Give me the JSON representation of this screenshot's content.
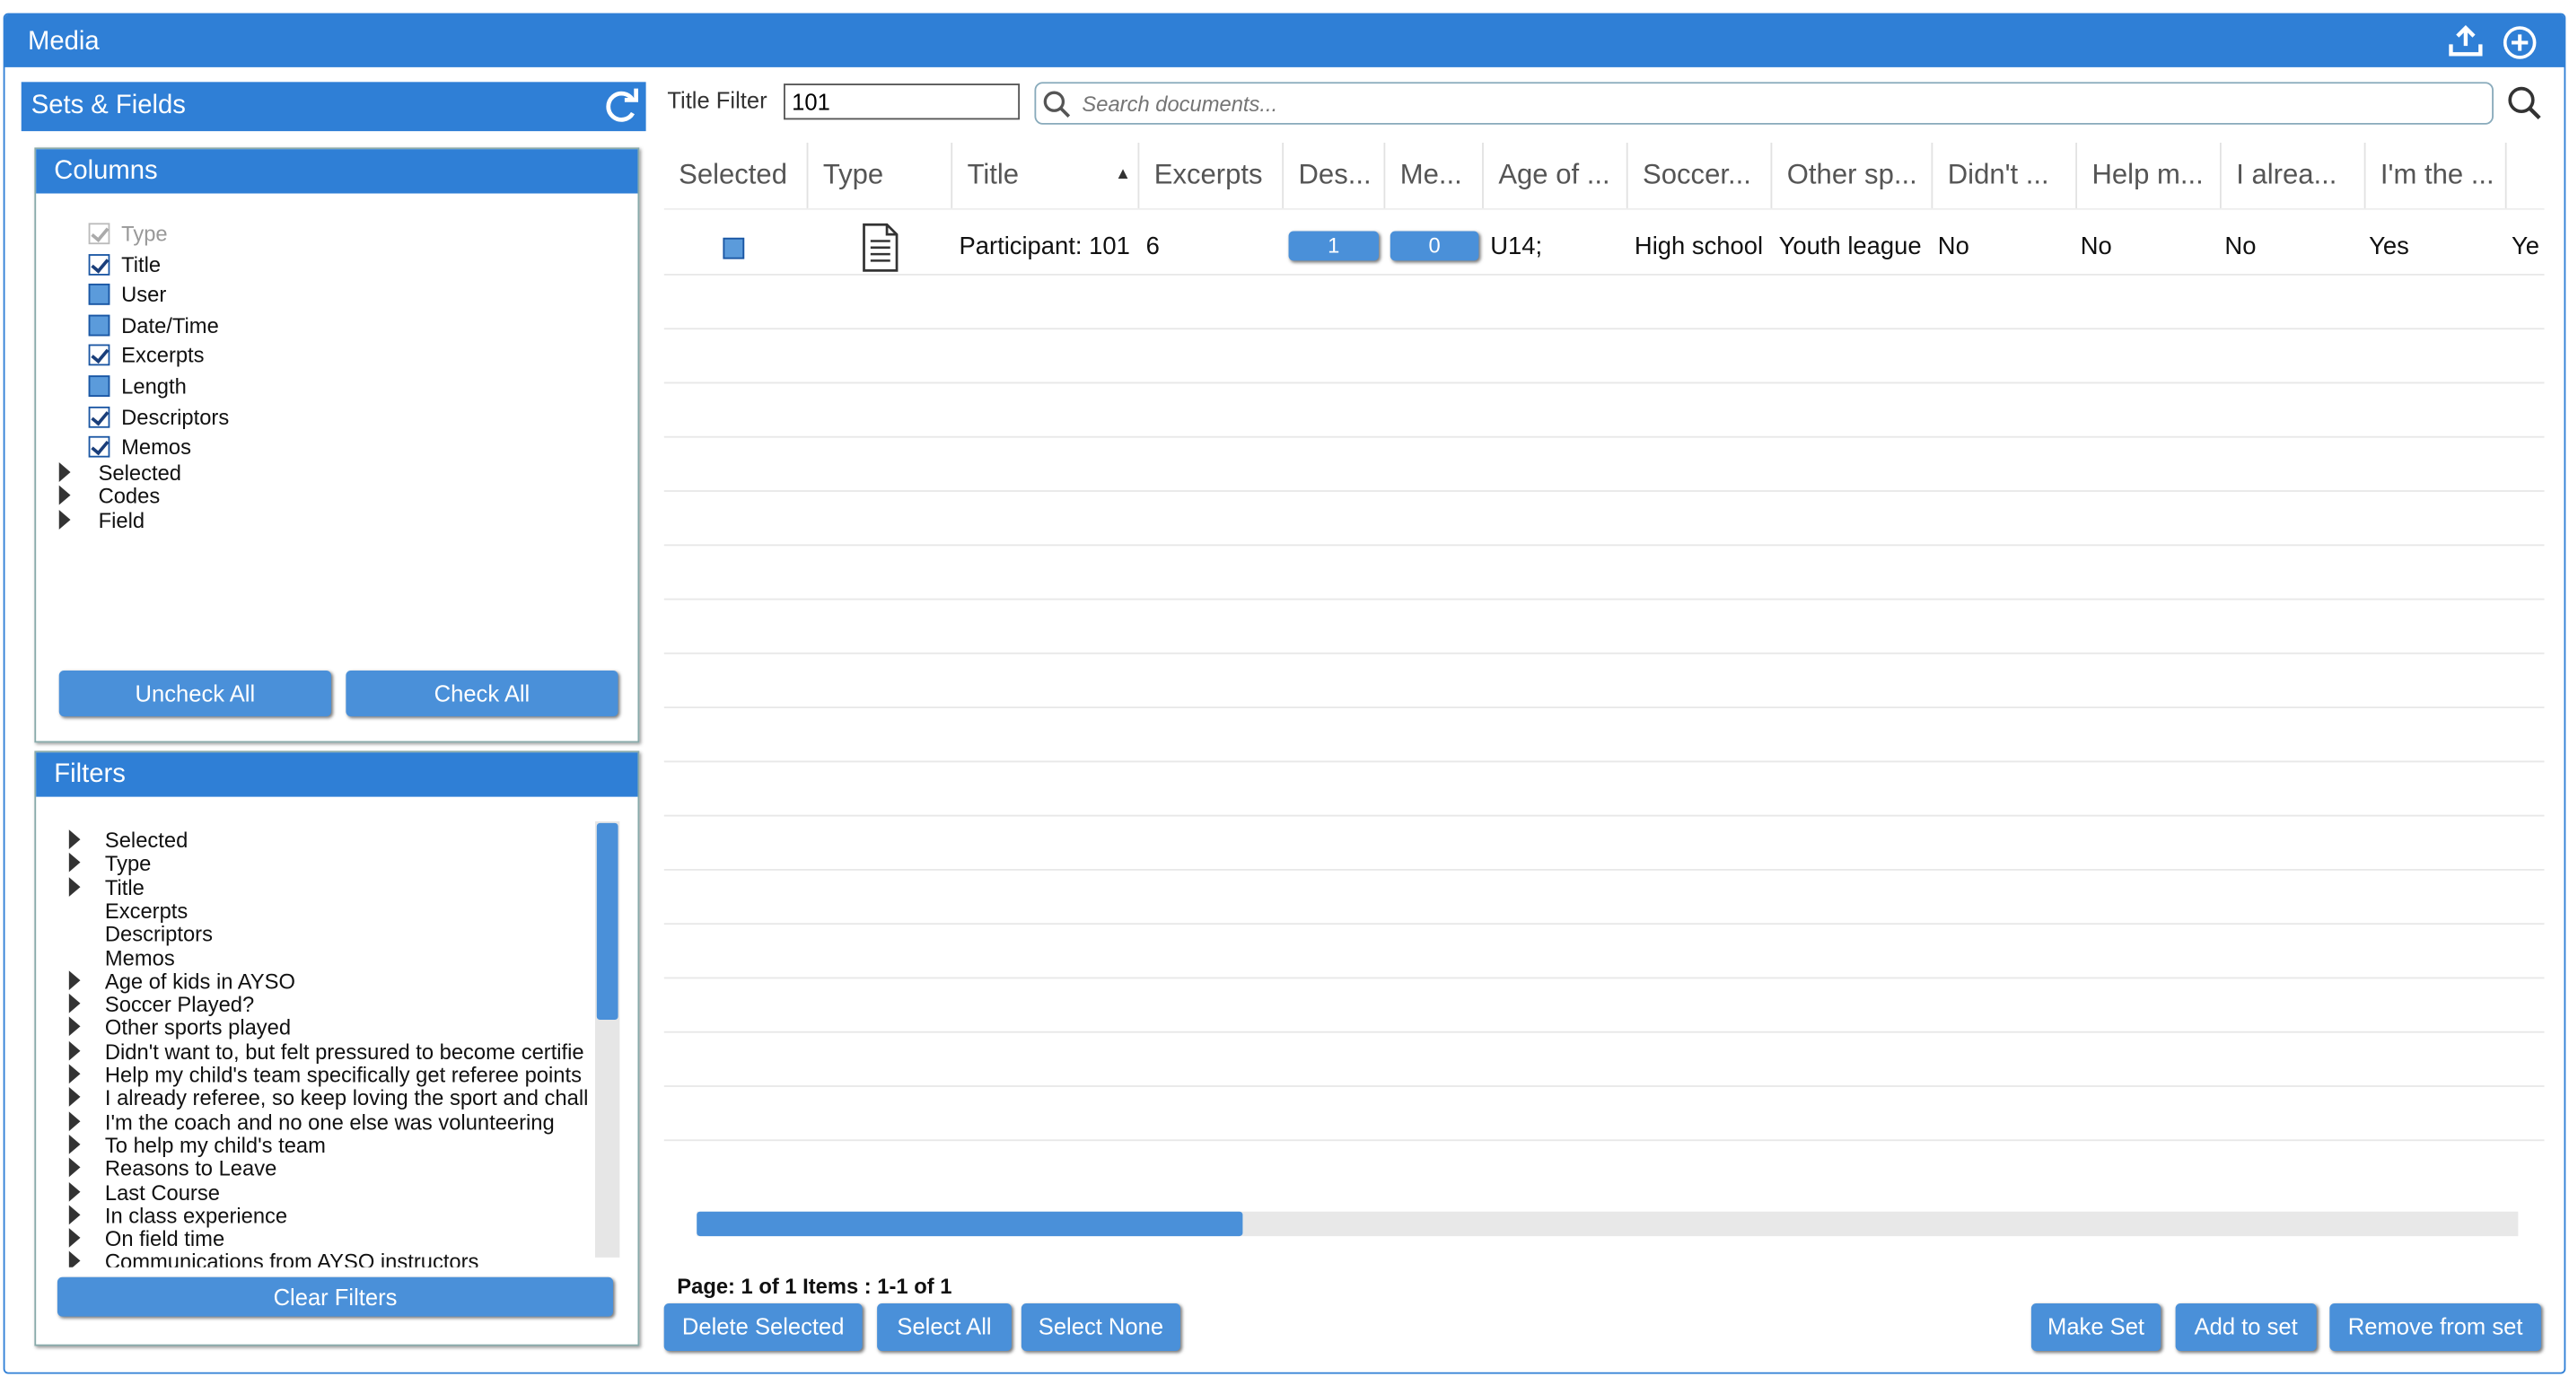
{
  "window": {
    "title": "Media"
  },
  "sets": {
    "header": "Sets & Fields"
  },
  "columns": {
    "header": "Columns",
    "items": [
      {
        "label": "Type",
        "state": "disabled-checked"
      },
      {
        "label": "Title",
        "state": "checked"
      },
      {
        "label": "User",
        "state": "unchecked"
      },
      {
        "label": "Date/Time",
        "state": "unchecked"
      },
      {
        "label": "Excerpts",
        "state": "checked"
      },
      {
        "label": "Length",
        "state": "unchecked"
      },
      {
        "label": "Descriptors",
        "state": "checked"
      },
      {
        "label": "Memos",
        "state": "checked"
      }
    ],
    "groups": [
      "Selected",
      "Codes",
      "Field"
    ],
    "uncheck_all": "Uncheck All",
    "check_all": "Check All"
  },
  "filters": {
    "header": "Filters",
    "items": [
      {
        "label": "Selected",
        "expandable": true
      },
      {
        "label": "Type",
        "expandable": true
      },
      {
        "label": "Title",
        "expandable": true
      },
      {
        "label": "Excerpts",
        "expandable": false
      },
      {
        "label": "Descriptors",
        "expandable": false
      },
      {
        "label": "Memos",
        "expandable": false
      },
      {
        "label": "Age of kids in AYSO",
        "expandable": true
      },
      {
        "label": "Soccer Played?",
        "expandable": true
      },
      {
        "label": "Other sports played",
        "expandable": true
      },
      {
        "label": "Didn't want to, but felt pressured to become certifie",
        "expandable": true
      },
      {
        "label": "Help my child's team specifically get referee points",
        "expandable": true
      },
      {
        "label": "I already referee, so keep loving the sport and chall",
        "expandable": true
      },
      {
        "label": "I'm the coach and no one else was volunteering",
        "expandable": true
      },
      {
        "label": "To help my child's team",
        "expandable": true
      },
      {
        "label": "Reasons to Leave",
        "expandable": true
      },
      {
        "label": "Last Course",
        "expandable": true
      },
      {
        "label": "In class experience",
        "expandable": true
      },
      {
        "label": "On field time",
        "expandable": true
      },
      {
        "label": "Communications from AYSO instructors",
        "expandable": true
      }
    ],
    "clear": "Clear Filters"
  },
  "toolbar": {
    "title_filter_label": "Title Filter",
    "title_filter_value": "101",
    "search_placeholder": "Search documents..."
  },
  "grid": {
    "headers": [
      "Selected",
      "Type",
      "Title",
      "Excerpts",
      "Des...",
      "Me...",
      "Age of ...",
      "Soccer...",
      "Other sp...",
      "Didn't ...",
      "Help m...",
      "I alrea...",
      "I'm the ..."
    ],
    "sort_indicator": "▲",
    "rows": [
      {
        "type_icon": "document-icon",
        "title": "Participant: 101",
        "excerpts": "6",
        "descriptors": "1",
        "memos": "0",
        "age": "U14;",
        "soccer": "High school",
        "other_sports": "Youth league",
        "didnt_want": "No",
        "help_team": "No",
        "already_ref": "No",
        "coach": "Yes",
        "next": "Ye"
      }
    ]
  },
  "pager": {
    "text": "Page: 1 of 1 Items : 1-1 of 1"
  },
  "scroll": {
    "horizontal_fraction": 0.3
  },
  "actions": {
    "delete_selected": "Delete Selected",
    "select_all": "Select All",
    "select_none": "Select None",
    "make_set": "Make Set",
    "add_to_set": "Add to set",
    "remove_from_set": "Remove from set"
  },
  "colors": {
    "accent": "#2f7fd6",
    "button": "#4a90d9"
  }
}
